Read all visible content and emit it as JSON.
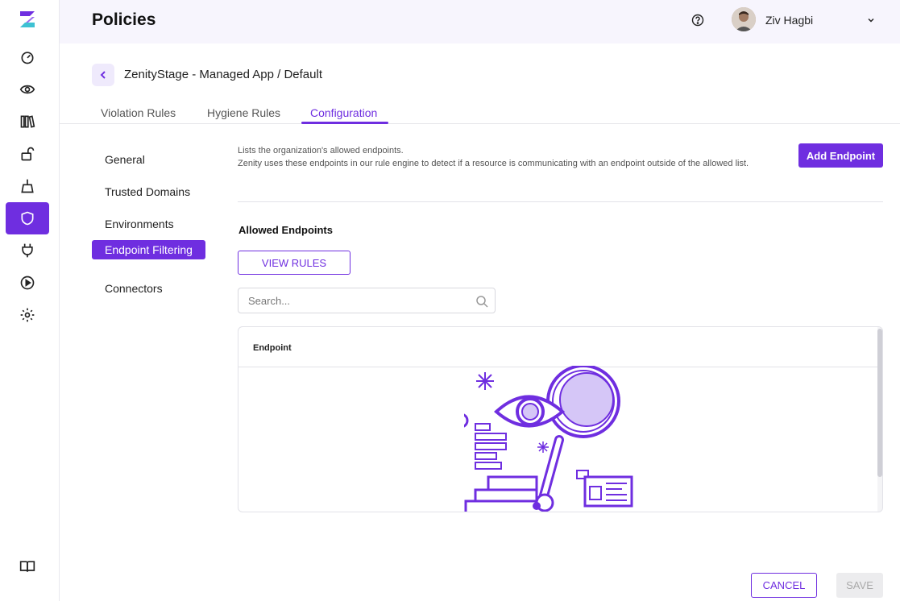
{
  "header": {
    "title": "Policies",
    "user_name": "Ziv Hagbi"
  },
  "breadcrumb": {
    "path": "ZenityStage - Managed App / Default"
  },
  "tabs": [
    {
      "label": "Violation Rules",
      "active": false
    },
    {
      "label": "Hygiene Rules",
      "active": false
    },
    {
      "label": "Configuration",
      "active": true
    }
  ],
  "side_menu": [
    {
      "label": "General",
      "active": false
    },
    {
      "label": "Trusted Domains",
      "active": false
    },
    {
      "label": "Environments",
      "active": false
    },
    {
      "label": "Endpoint Filtering",
      "active": true
    },
    {
      "label": "Connectors",
      "active": false
    }
  ],
  "content": {
    "description_line1": "Lists the organization's allowed endpoints.",
    "description_line2": "Zenity uses these endpoints in our rule engine to detect if a resource is communicating with an endpoint outside of the allowed list.",
    "add_button": "Add Endpoint",
    "section_title": "Allowed Endpoints",
    "view_rules_button": "VIEW RULES",
    "search_placeholder": "Search...",
    "table_column": "Endpoint"
  },
  "footer": {
    "cancel": "CANCEL",
    "save": "SAVE"
  },
  "rail_icons": [
    "dashboard-icon",
    "eye-icon",
    "library-icon",
    "unlock-icon",
    "broom-icon",
    "shield-icon",
    "plug-icon",
    "play-icon",
    "gear-icon",
    "book-icon"
  ],
  "colors": {
    "accent": "#6f2ee0",
    "header_bg": "#f7f5fd"
  }
}
